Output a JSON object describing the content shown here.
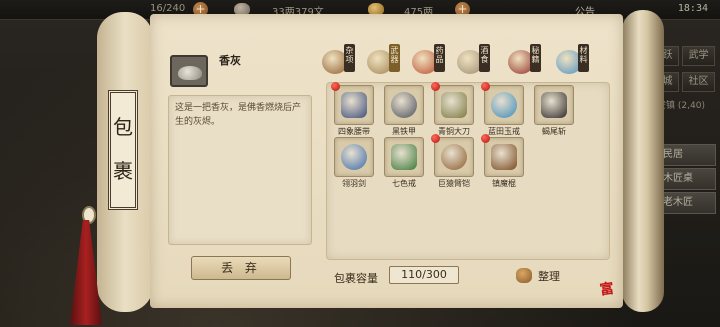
{
  "topbar": {
    "stamina": "16/240",
    "copper": "33两379文",
    "silver": "475两",
    "notice": "公告",
    "time": "18:34"
  },
  "right_menu": {
    "buttons": [
      "活跃",
      "武学",
      "商城",
      "社区"
    ],
    "location": "春安镇",
    "coords": "(2,40)",
    "panels": [
      "民居",
      "木匠桌",
      "老木匠"
    ]
  },
  "title": "包裹",
  "selected_item": {
    "name": "香灰",
    "description": "这是一把香灰，是佛香燃烧后产生的灰烬。"
  },
  "drop_button": "丢 弃",
  "tabs": [
    {
      "label": "杂项",
      "icon": "gourd-icon",
      "color": "#8b5a2b"
    },
    {
      "label": "武器",
      "icon": "weapon-icon",
      "color": "#a08050"
    },
    {
      "label": "药品",
      "icon": "herb-icon",
      "color": "#b84a2a"
    },
    {
      "label": "酒食",
      "icon": "wine-icon",
      "color": "#9a8a70"
    },
    {
      "label": "秘籍",
      "icon": "book-icon",
      "color": "#8e2a24"
    },
    {
      "label": "材料",
      "icon": "crystal-icon",
      "color": "#4a8fc2"
    }
  ],
  "items": [
    {
      "name": "四象腰带",
      "icon": "belt-icon",
      "new": true,
      "color": "#3e4e7a"
    },
    {
      "name": "黑铁甲",
      "icon": "armor-icon",
      "new": false,
      "color": "#4a4e5a"
    },
    {
      "name": "青铜大刀",
      "icon": "broadsword-icon",
      "new": true,
      "color": "#7a7a40"
    },
    {
      "name": "蓝田玉戒",
      "icon": "jade-ring-icon",
      "new": true,
      "color": "#3a8ab8"
    },
    {
      "name": "蝎尾斩",
      "icon": "scorpion-blade-icon",
      "new": false,
      "color": "#2e2a2a"
    },
    {
      "name": "翎羽剑",
      "icon": "feather-sword-icon",
      "new": false,
      "color": "#3a6aa8"
    },
    {
      "name": "七色戒",
      "icon": "seven-color-ring-icon",
      "new": false,
      "color": "#3c7a3a"
    },
    {
      "name": "巨猿臂铠",
      "icon": "gauntlet-icon",
      "new": true,
      "color": "#8a5a2a"
    },
    {
      "name": "镇魔棍",
      "icon": "staff-icon",
      "new": true,
      "color": "#7a4a20"
    }
  ],
  "capacity": {
    "label": "包裹容量",
    "value": "110/300"
  },
  "sort_button": "整理",
  "seal_text": "富升"
}
